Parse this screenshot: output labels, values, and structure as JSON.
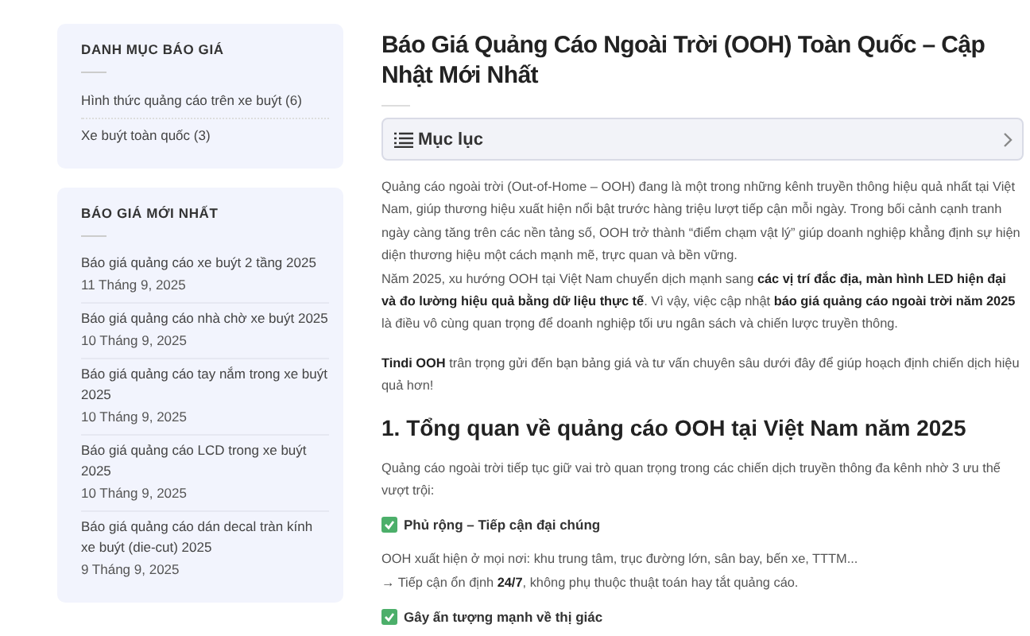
{
  "sidebar": [
    {
      "kind": "categories",
      "title": "DANH MỤC BÁO GIÁ",
      "items": [
        {
          "label": "Hình thức quảng cáo trên xe buýt (6)"
        },
        {
          "label": "Xe buýt toàn quốc (3)"
        }
      ]
    },
    {
      "kind": "posts",
      "title": "BÁO GIÁ MỚI NHẤT",
      "items": [
        {
          "label": "Báo giá quảng cáo xe buýt 2 tầng 2025",
          "date": "11 Tháng 9, 2025"
        },
        {
          "label": "Báo giá quảng cáo nhà chờ xe buýt 2025",
          "date": "10 Tháng 9, 2025"
        },
        {
          "label": "Báo giá quảng cáo tay nắm trong xe buýt 2025",
          "date": "10 Tháng 9, 2025"
        },
        {
          "label": "Báo giá quảng cáo LCD trong xe buýt 2025",
          "date": "10 Tháng 9, 2025"
        },
        {
          "label": "Báo giá quảng cáo dán decal tràn kính xe buýt (die-cut) 2025",
          "date": "9 Tháng 9, 2025"
        }
      ]
    }
  ],
  "article": {
    "title": "Báo Giá Quảng Cáo Ngoài Trời (OOH) Toàn Quốc – Cập Nhật Mới Nhất",
    "toc": {
      "label": "Mục lục",
      "expanded": false
    },
    "blocks": [
      {
        "kind": "paragraph",
        "lines": [
          "Quảng cáo ngoài trời (Out-of-Home – OOH) đang là một trong những kênh truyền thông hiệu quả nhất tại Việt Nam, giúp thương hiệu xuất hiện nổi bật trước hàng triệu lượt tiếp cận mỗi ngày. Trong bối cảnh cạnh tranh ngày càng tăng trên các nền tảng số, OOH trở thành “điểm chạm vật lý” giúp doanh nghiệp khẳng định sự hiện diện thương hiệu một cách mạnh mẽ, trực quan và bền vững.",
          "Năm 2025, xu hướng OOH tại Việt Nam chuyển dịch mạnh sang **các vị trí đắc địa, màn hình LED hiện đại và đo lường hiệu quả bằng dữ liệu thực tế**. Vì vậy, việc cập nhật **báo giá quảng cáo ngoài trời năm 2025** là điều vô cùng quan trọng để doanh nghiệp tối ưu ngân sách và chiến lược truyền thông."
        ]
      },
      {
        "kind": "paragraph",
        "lines": [
          "**Tindi OOH** trân trọng gửi đến bạn bảng giá và tư vấn chuyên sâu dưới đây để giúp hoạch định chiến dịch hiệu quả hơn!"
        ]
      },
      {
        "kind": "heading",
        "text": "1. Tổng quan về quảng cáo OOH tại Việt Nam năm 2025"
      },
      {
        "kind": "paragraph",
        "lines": [
          "Quảng cáo ngoài trời tiếp tục giữ vai trò quan trọng trong các chiến dịch truyền thông đa kênh nhờ 3 ưu thế vượt trội:"
        ]
      },
      {
        "kind": "feature",
        "text": "Phủ rộng – Tiếp cận đại chúng"
      },
      {
        "kind": "paragraph",
        "lines": [
          "OOH xuất hiện ở mọi nơi: khu trung tâm, trục đường lớn, sân bay, bến xe, TTTM...",
          "→ Tiếp cận ổn định **24/7**, không phụ thuộc thuật toán hay tắt quảng cáo."
        ]
      },
      {
        "kind": "feature",
        "text": "Gây ấn tượng mạnh về thị giác"
      }
    ]
  }
}
